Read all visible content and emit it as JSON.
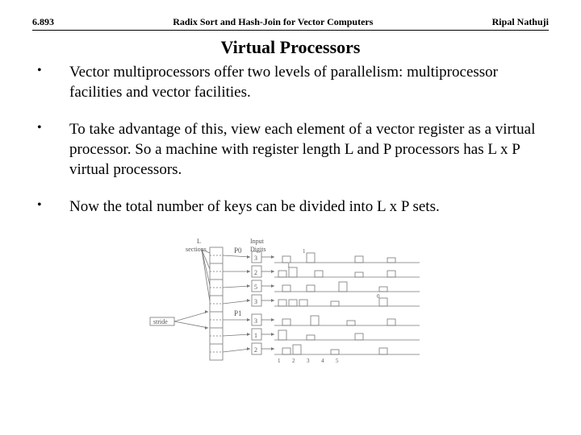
{
  "header": {
    "left": "6.893",
    "center": "Radix Sort and Hash-Join for Vector Computers",
    "right": "Ripal Nathuji"
  },
  "title": "Virtual Processors",
  "bullets": [
    "Vector multiprocessors offer two levels of parallelism: multiprocessor facilities and vector facilities.",
    "To take advantage of this, view each element of a vector register as a virtual processor.  So a machine with register length L and P processors has L x P virtual processors.",
    "Now the total number of keys can be divided into L x P sets."
  ],
  "figure": {
    "labels": {
      "top_left": "L",
      "top_left2": "sections",
      "top_right": "Input",
      "top_right2": "Digits",
      "p0": "P0",
      "p1": "P1",
      "stride": "stride"
    },
    "digits": [
      "3",
      "2",
      "5",
      "3",
      "3",
      "1",
      "2"
    ],
    "tick_nums": [
      "1",
      "2",
      "3",
      "4",
      "5",
      "1",
      "2"
    ]
  }
}
